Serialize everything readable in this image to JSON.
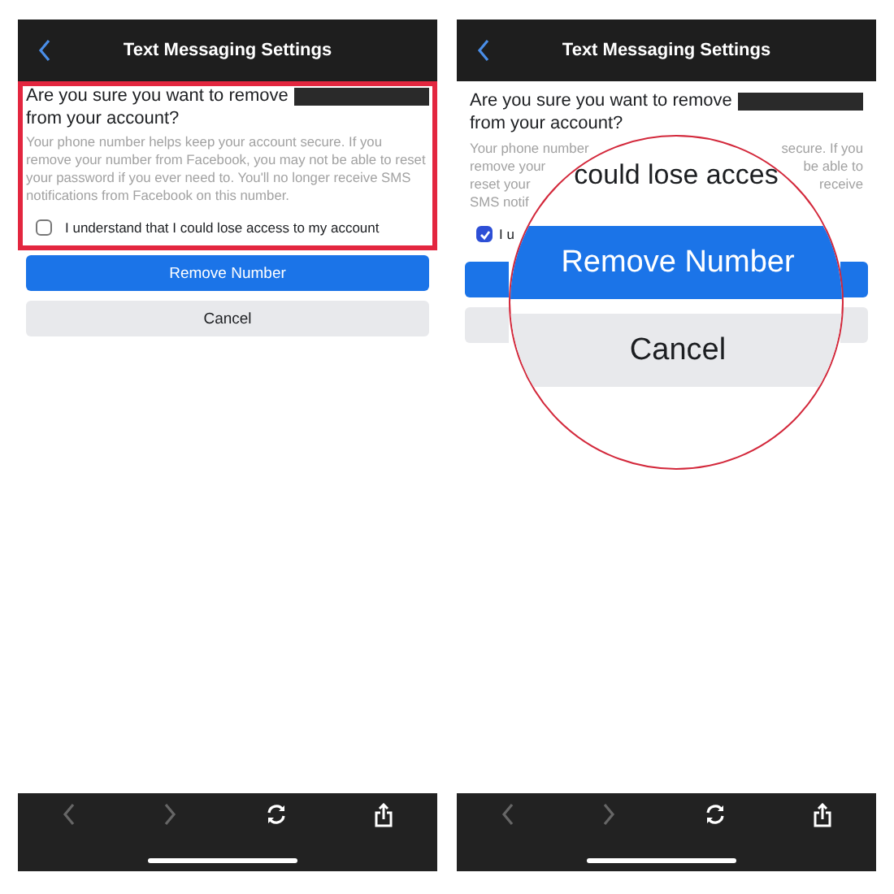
{
  "panels": [
    {
      "header": {
        "title": "Text Messaging Settings"
      },
      "highlighted": true,
      "question": [
        "Are you sure you want to remove",
        "from your account?"
      ],
      "redacted": true,
      "body": "Your phone number helps keep your account secure. If you remove your number from Facebook, you may not be able to reset your password if you ever need to. You'll no longer receive SMS notifications from Facebook on this number.",
      "checkbox": {
        "checked": false,
        "label": "I understand that I could lose access to my account"
      },
      "buttons": [
        {
          "kind": "primary",
          "label": "Remove Number"
        },
        {
          "kind": "secondary",
          "label": "Cancel"
        }
      ],
      "toolbar": {
        "back_disabled": true,
        "forward_disabled": true
      }
    },
    {
      "header": {
        "title": "Text Messaging Settings"
      },
      "highlighted": false,
      "question": [
        "Are you sure you want to remove",
        "from your account?"
      ],
      "redacted": true,
      "body_fragments": [
        {
          "left": "Your phone number",
          "right": "secure. If you"
        },
        {
          "left": "remove your",
          "right": "be able to"
        },
        {
          "left": "reset your",
          "right": "receive"
        },
        {
          "left": "SMS notif"
        }
      ],
      "checkbox": {
        "checked": true,
        "label": "I u"
      },
      "buttons": [
        {
          "kind": "primary"
        },
        {
          "kind": "secondary"
        }
      ],
      "magnifier": {
        "caption": "could lose acces",
        "buttons": [
          {
            "kind": "primary",
            "label": "Remove Number"
          },
          {
            "kind": "secondary",
            "label": "Cancel"
          }
        ]
      },
      "toolbar": {
        "back_disabled": true,
        "forward_disabled": true
      }
    }
  ]
}
